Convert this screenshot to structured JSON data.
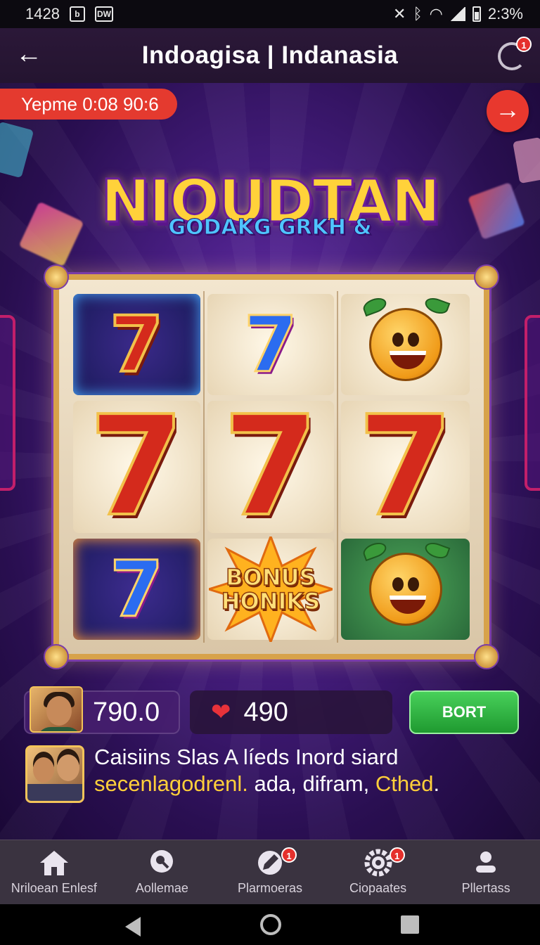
{
  "status_bar": {
    "time": "1428",
    "right_text": "2:3%",
    "left_icon_b": "notification-icon",
    "left_icon_dw": "DW"
  },
  "header": {
    "title": "Indoagisa | Indanasia",
    "refresh_badge": "1"
  },
  "game": {
    "timer_label": "Yepme 0:08 90:6",
    "logo_title": "NIOUDTAN",
    "logo_subtitle": "GODAKG GRKH &",
    "reels": [
      {
        "symbol": "seven",
        "color": "red",
        "size": "small",
        "text": "7"
      },
      {
        "symbol": "seven",
        "color": "blue",
        "size": "small",
        "text": "7"
      },
      {
        "symbol": "fruit",
        "text": ""
      },
      {
        "symbol": "seven",
        "color": "red",
        "size": "big",
        "text": "7"
      },
      {
        "symbol": "seven",
        "color": "red",
        "size": "big",
        "text": "7"
      },
      {
        "symbol": "seven",
        "color": "red",
        "size": "big",
        "text": "7"
      },
      {
        "symbol": "seven",
        "color": "blue",
        "size": "small",
        "text": "7"
      },
      {
        "symbol": "bonus",
        "line1": "BONUS",
        "line2": "HONIKS"
      },
      {
        "symbol": "fruit",
        "text": ""
      }
    ]
  },
  "player": {
    "score": "790.0",
    "lives": "490",
    "action_label": "BORT"
  },
  "chat": {
    "line1": "Caisiins Slas A líeds Inord siard",
    "line2_highlight": "secenlagodrenl.",
    "line2_middle": " ada, difram, ",
    "line2_end_highlight": "Cthed",
    "line2_tail": "."
  },
  "bottom_nav": {
    "items": [
      {
        "label": "Nriloean Enlesf",
        "icon": "home-icon"
      },
      {
        "label": "Aollemae",
        "icon": "search-icon"
      },
      {
        "label": "Plarmoeras",
        "icon": "edit-icon",
        "badge": "1"
      },
      {
        "label": "Ciopaates",
        "icon": "settings-icon",
        "badge": "1"
      },
      {
        "label": "Pllertass",
        "icon": "profile-icon"
      }
    ]
  },
  "colors": {
    "accent_red": "#e43a2f",
    "action_green": "#34b847",
    "highlight_yellow": "#ffcf3a",
    "bg_purple": "#4a1f86"
  }
}
